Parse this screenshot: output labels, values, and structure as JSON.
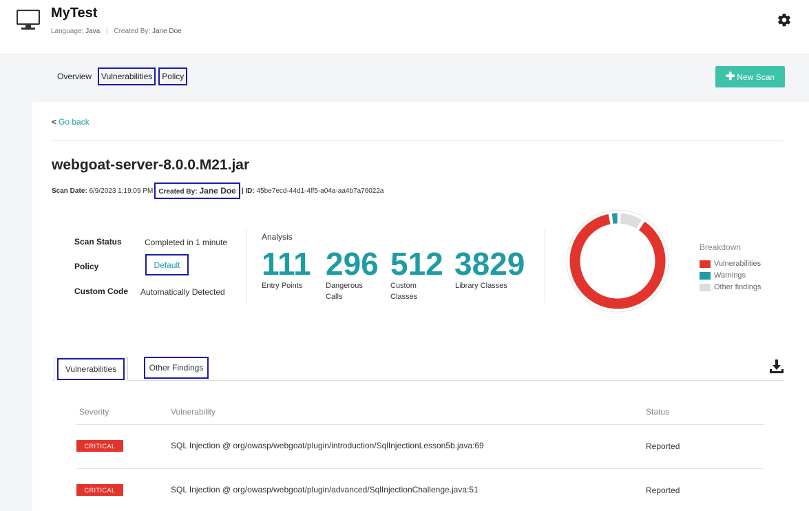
{
  "header": {
    "title": "MyTest",
    "language_label": "Language:",
    "language_value": "Java",
    "separator": "|",
    "created_label": "Created By:",
    "created_value": "Jane Doe"
  },
  "nav": {
    "items": [
      "Overview",
      "Vulnerabilities",
      "Policy"
    ],
    "new_scan_label": "New Scan"
  },
  "scan": {
    "go_back": "Go back",
    "file_name": "webgoat-server-8.0.0.M21.jar",
    "scan_date_label": "Scan Date:",
    "scan_date_value": "6/9/2023 1:19:09 PM",
    "created_by_label": "Created By:",
    "created_by_value": "Jane Doe",
    "id_label": "| ID:",
    "id_value": "45be7ecd-44d1-4ff5-a04a-aa4b7a76022a"
  },
  "info": {
    "scan_status_label": "Scan Status",
    "scan_status_value": "Completed in 1 minute",
    "policy_label": "Policy",
    "policy_value": "Default",
    "custom_code_label": "Custom Code",
    "custom_code_value": "Automatically Detected"
  },
  "analysis": {
    "title": "Analysis",
    "stats": [
      {
        "value": "111",
        "label_line1": "Entry Points",
        "label_line2": ""
      },
      {
        "value": "296",
        "label_line1": "Dangerous",
        "label_line2": "Calls"
      },
      {
        "value": "512",
        "label_line1": "Custom",
        "label_line2": "Classes"
      },
      {
        "value": "3829",
        "label_line1": "Library Classes",
        "label_line2": ""
      }
    ]
  },
  "breakdown": {
    "title": "Breakdown",
    "legend": [
      {
        "label": "Vulnerabilities",
        "color": "#e2342c"
      },
      {
        "label": "Warnings",
        "color": "#1f9ca3"
      },
      {
        "label": "Other findings",
        "color": "#dddddd"
      }
    ],
    "shares": {
      "vulnerabilities": 0.885,
      "warnings": 0.03,
      "other": 0.085
    }
  },
  "tabs": {
    "items": [
      "Vulnerabilities",
      "Other Findings"
    ],
    "active": "Vulnerabilities"
  },
  "table": {
    "headers": {
      "severity": "Severity",
      "vulnerability": "Vulnerability",
      "status": "Status"
    },
    "rows": [
      {
        "severity": "CRITICAL",
        "vulnerability": "SQL Injection @ org/owasp/webgoat/plugin/introduction/SqlInjectionLesson5b.java:69",
        "status": "Reported"
      },
      {
        "severity": "CRITICAL",
        "vulnerability": "SQL Injection @ org/owasp/webgoat/plugin/advanced/SqlInjectionChallenge.java:51",
        "status": "Reported"
      }
    ]
  },
  "icons": {
    "monitor": "monitor-icon",
    "settings": "gear-icon",
    "add": "plus-icon",
    "download": "download-icon"
  },
  "colors": {
    "accent_teal": "#1f9ca3",
    "button_green": "#3cc3a8",
    "critical_red": "#e2342c",
    "highlight_box": "#1a1aa8"
  }
}
